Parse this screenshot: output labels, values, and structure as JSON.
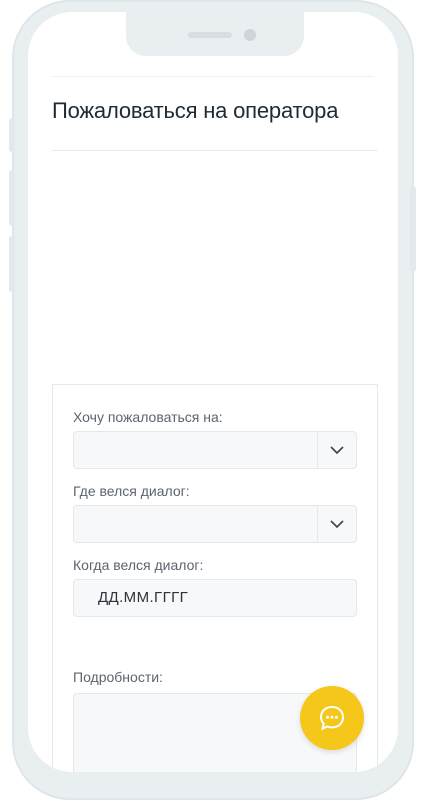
{
  "page": {
    "title": "Пожаловаться на оператора"
  },
  "form": {
    "complaint_target": {
      "label": "Хочу пожаловаться на:",
      "value": ""
    },
    "dialog_place": {
      "label": "Где велся диалог:",
      "value": ""
    },
    "dialog_date": {
      "label": "Когда велся диалог:",
      "placeholder": "ДД.ММ.ГГГГ"
    },
    "details": {
      "label": "Подробности:",
      "value": ""
    }
  },
  "icons": {
    "dropdown": "chevron-down-icon",
    "chat": "chat-bubble-icon"
  },
  "colors": {
    "accent": "#f6c71b",
    "title": "#1f2a33",
    "field_bg": "#f6f8fa"
  }
}
